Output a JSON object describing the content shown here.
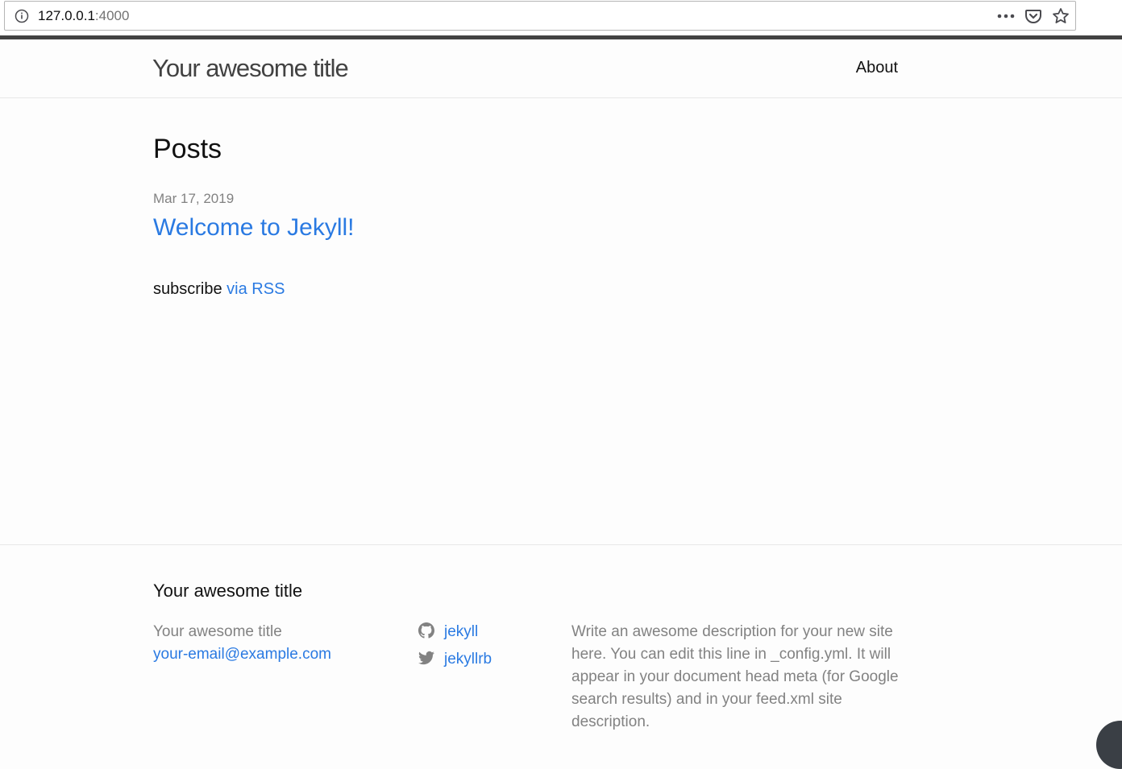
{
  "browser": {
    "url_host": "127.0.0.1",
    "url_port": ":4000",
    "icons": [
      "info-icon",
      "more-icon",
      "pocket-icon",
      "bookmark-star-icon"
    ]
  },
  "header": {
    "site_title": "Your awesome title",
    "nav": [
      {
        "label": "About"
      }
    ]
  },
  "main": {
    "heading": "Posts",
    "posts": [
      {
        "date": "Mar 17, 2019",
        "title": "Welcome to Jekyll!"
      }
    ],
    "rss_prefix": "subscribe",
    "rss_link": "via RSS"
  },
  "footer": {
    "heading": "Your awesome title",
    "name": "Your awesome title",
    "email": "your-email@example.com",
    "social": [
      {
        "icon": "github-icon",
        "label": "jekyll"
      },
      {
        "icon": "twitter-icon",
        "label": "jekyllrb"
      }
    ],
    "description": "Write an awesome description for your new site here. You can edit this line in _config.yml. It will appear in your document head meta (for Google search results) and in your feed.xml site description."
  },
  "colors": {
    "link": "#2a7ae2",
    "meta_text": "#828282",
    "top_bar": "#424242"
  }
}
